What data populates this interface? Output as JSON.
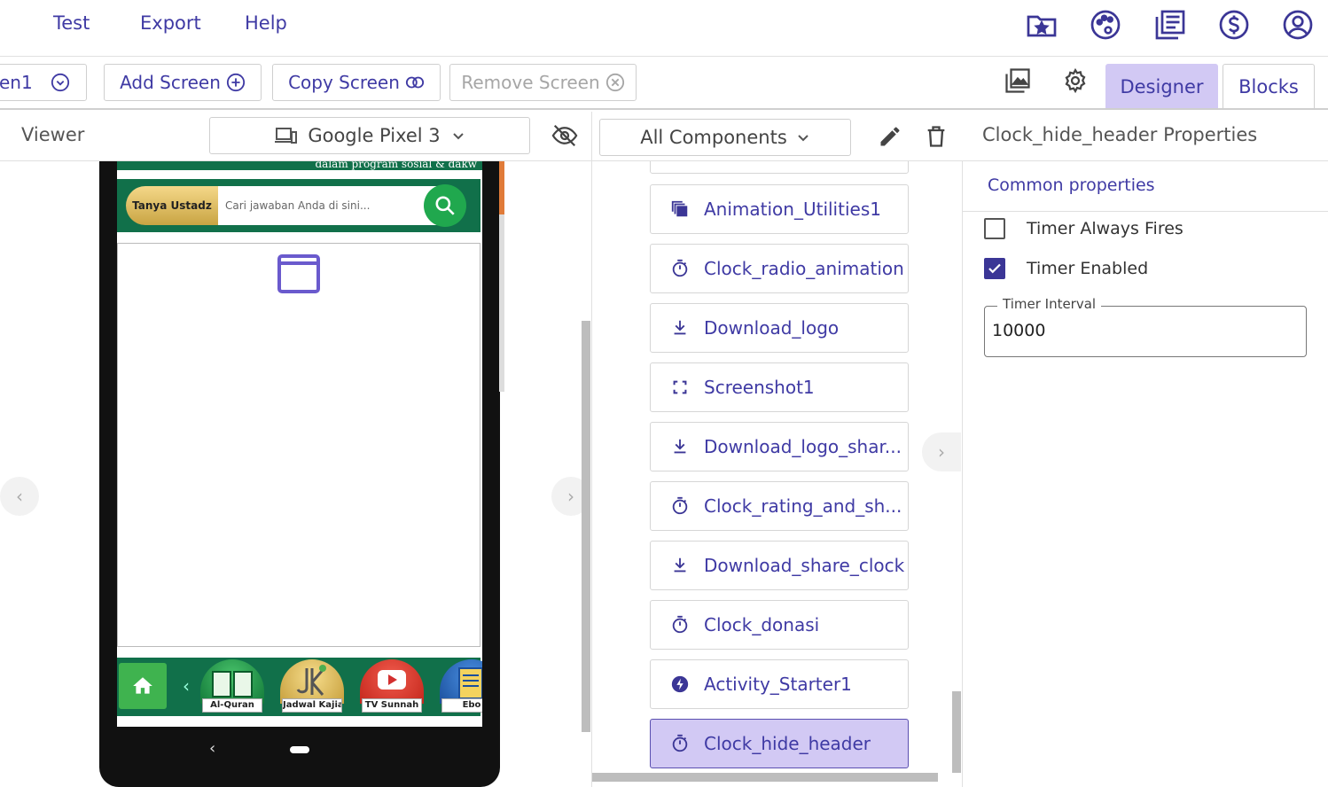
{
  "menu": {
    "test": "Test",
    "export": "Export",
    "help": "Help"
  },
  "top_icons": [
    "folder-star-icon",
    "palette-icon",
    "gallery-icon",
    "dollar-icon",
    "account-icon"
  ],
  "toolbar": {
    "screen_select": "en1",
    "add_screen": "Add Screen",
    "copy_screen": "Copy Screen",
    "remove_screen": "Remove Screen",
    "designer": "Designer",
    "blocks": "Blocks"
  },
  "viewer": {
    "title": "Viewer",
    "device": "Google Pixel 3",
    "app": {
      "banner_text": "dalam program sosial & dakw",
      "search_chip": "Tanya Ustadz",
      "search_placeholder": "Cari jawaban Anda di sini...",
      "tiles": [
        "Al-Quran",
        "Jadwal Kajian",
        "TV Sunnah",
        "Ebo"
      ]
    }
  },
  "components": {
    "filter": "All Components",
    "items": [
      {
        "label": "Animation_Utilities1",
        "icon": "layers-icon"
      },
      {
        "label": "Clock_radio_animation",
        "icon": "timer-icon"
      },
      {
        "label": "Download_logo",
        "icon": "download-icon"
      },
      {
        "label": "Screenshot1",
        "icon": "screenshot-icon"
      },
      {
        "label": "Download_logo_shar...",
        "icon": "download-icon"
      },
      {
        "label": "Clock_rating_and_sh...",
        "icon": "timer-icon"
      },
      {
        "label": "Download_share_clock",
        "icon": "download-icon"
      },
      {
        "label": "Clock_donasi",
        "icon": "timer-icon"
      },
      {
        "label": "Activity_Starter1",
        "icon": "bolt-icon"
      },
      {
        "label": "Clock_hide_header",
        "icon": "timer-icon",
        "selected": true
      }
    ]
  },
  "properties": {
    "title": "Clock_hide_header Properties",
    "section": "Common properties",
    "timer_always_fires": {
      "label": "Timer Always Fires",
      "checked": false
    },
    "timer_enabled": {
      "label": "Timer Enabled",
      "checked": true
    },
    "timer_interval": {
      "label": "Timer Interval",
      "value": "10000"
    }
  },
  "colors": {
    "accent": "#3f3aa4",
    "selected": "#d2c9f4",
    "app_green": "#11704a"
  }
}
